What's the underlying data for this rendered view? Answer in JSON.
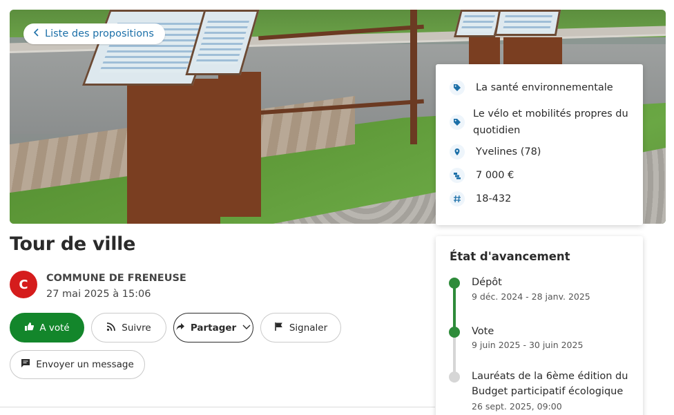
{
  "hero": {
    "back_link_label": "Liste des propositions"
  },
  "info": {
    "items": [
      {
        "icon": "tag-icon",
        "label": "La santé environnementale"
      },
      {
        "icon": "tag-icon",
        "label": "Le vélo et mobilités propres du quotidien"
      },
      {
        "icon": "location-pin-icon",
        "label": "Yvelines (78)"
      },
      {
        "icon": "budget-icon",
        "label": "7 000 €"
      },
      {
        "icon": "hash-icon",
        "label": "18-432"
      }
    ]
  },
  "proposal": {
    "title": "Tour de ville",
    "author_initial": "C",
    "author_name": "COMMUNE DE FRENEUSE",
    "date": "27 mai 2025 à 15:06"
  },
  "actions": {
    "vote_label": "A voté",
    "follow_label": "Suivre",
    "share_label": "Partager",
    "report_label": "Signaler",
    "message_label": "Envoyer un message"
  },
  "progress": {
    "title": "État d'avancement",
    "steps": [
      {
        "name": "Dépôt",
        "dates": "9 déc. 2024 - 28 janv. 2025",
        "status": "done"
      },
      {
        "name": "Vote",
        "dates": "9 juin 2025 - 30 juin 2025",
        "status": "done"
      },
      {
        "name": "Lauréats de la 6ème édition du Budget participatif écologique",
        "dates": "26 sept. 2025, 09:00",
        "status": "upcoming"
      }
    ]
  },
  "colors": {
    "accent_blue": "#1b6fa8",
    "vote_green": "#13862b",
    "avatar_red": "#d51c1c"
  }
}
